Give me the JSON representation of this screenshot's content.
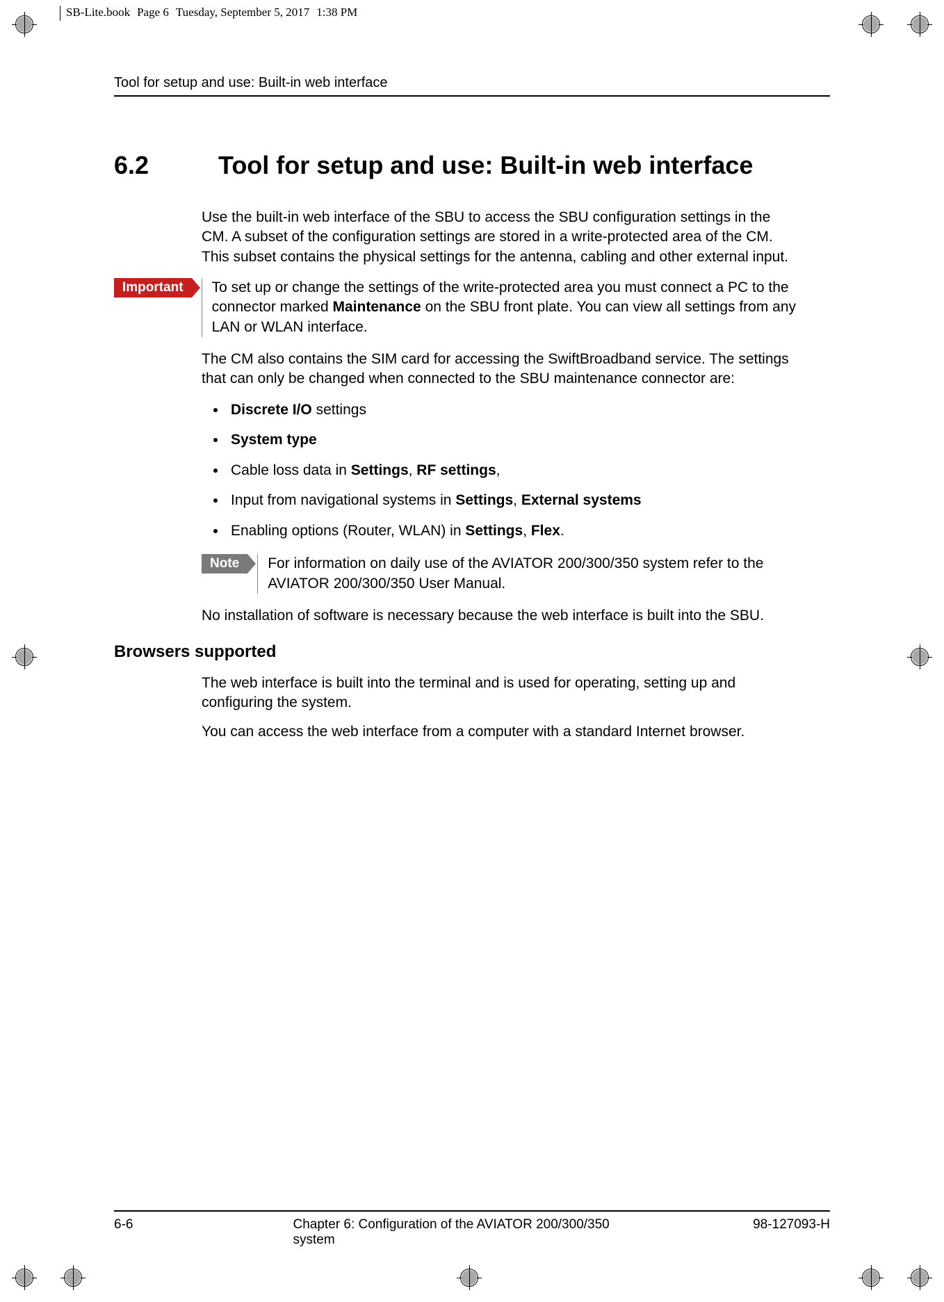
{
  "meta": {
    "book": "SB-Lite.book",
    "page_stamp": "Page 6",
    "date_stamp": "Tuesday, September 5, 2017",
    "time_stamp": "1:38 PM"
  },
  "header": {
    "running": "Tool for setup and use: Built-in web interface"
  },
  "section": {
    "number": "6.2",
    "title": "Tool for setup and use: Built-in web interface"
  },
  "body": {
    "p1": "Use the built-in web interface of the SBU to access the SBU configuration settings in the CM. A subset of the configuration settings are stored in a write-protected area of the CM. This subset contains the physical settings for the antenna, cabling and other external input.",
    "important_label": "Important",
    "important_text_pre": "To set up or change the settings of the write-protected area you must connect a PC to the connector marked ",
    "important_bold": "Maintenance",
    "important_text_post": " on the SBU front plate. You can view all settings from any LAN or WLAN interface.",
    "p2": "The CM also contains the SIM card for accessing the SwiftBroadband service. The settings that can only be changed when connected to the SBU maintenance connector are:",
    "bullets": {
      "b1_bold": "Discrete I/O",
      "b1_tail": " settings",
      "b2_bold": "System type",
      "b3_pre": "Cable loss data in ",
      "b3_bold1": "Settings",
      "b3_sep": ", ",
      "b3_bold2": "RF settings",
      "b3_tail": ",",
      "b4_pre": "Input from navigational systems in ",
      "b4_bold1": "Settings",
      "b4_sep": ", ",
      "b4_bold2": "External systems",
      "b5_pre": "Enabling options (Router, WLAN) in ",
      "b5_bold1": "Settings",
      "b5_sep": ", ",
      "b5_bold2": "Flex",
      "b5_tail": "."
    },
    "note_label": "Note",
    "note_text": "For information on daily use of the AVIATOR 200/300/350 system refer to the AVIATOR 200/300/350 User Manual.",
    "p3": "No installation of software is necessary because the web interface is built into the SBU.",
    "subheading": "Browsers supported",
    "p4": "The web interface is built into the terminal and is used for operating, setting up and configuring the system.",
    "p5": "You can access the web interface from a computer with a standard Internet browser."
  },
  "footer": {
    "page": "6-6",
    "chapter": "Chapter 6:  Configuration of the AVIATOR 200/300/350 system",
    "docnum": "98-127093-H"
  }
}
